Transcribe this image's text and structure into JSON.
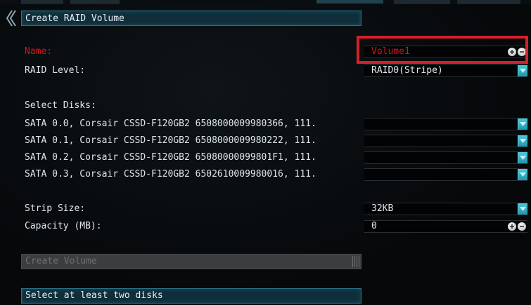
{
  "window": {
    "title": "Create RAID Volume"
  },
  "form": {
    "name": {
      "label": "Name:",
      "value": "Volume1"
    },
    "raid_level": {
      "label": "RAID Level:",
      "value": "RAID0(Stripe)"
    },
    "select_disks": {
      "label": "Select Disks:",
      "disks": [
        {
          "label": "SATA 0.0, Corsair CSSD-F120GB2 6508000009980366, 111.",
          "value": ""
        },
        {
          "label": "SATA 0.1, Corsair CSSD-F120GB2 6508000009980222, 111.",
          "value": ""
        },
        {
          "label": "SATA 0.2, Corsair CSSD-F120GB2 65080000099801F1, 111.",
          "value": ""
        },
        {
          "label": "SATA 0.3, Corsair CSSD-F120GB2 6502610009980016, 111.",
          "value": ""
        }
      ]
    },
    "strip_size": {
      "label": "Strip Size:",
      "value": "32KB"
    },
    "capacity": {
      "label": "Capacity (MB):",
      "value": "0"
    }
  },
  "actions": {
    "create_label": "Create Volume"
  },
  "status": {
    "message": "Select at least two disks"
  },
  "icons": {
    "back": "chevron-left-icon",
    "dropdown": "dropdown-arrow-icon",
    "plus": "plus-icon",
    "minus": "minus-icon"
  },
  "colors": {
    "accent": "#1f97ad",
    "highlight": "#d4202a",
    "required_label": "#d4151f",
    "title_bar": "#0f2e3a",
    "disabled_button": "#3b3d3e"
  }
}
